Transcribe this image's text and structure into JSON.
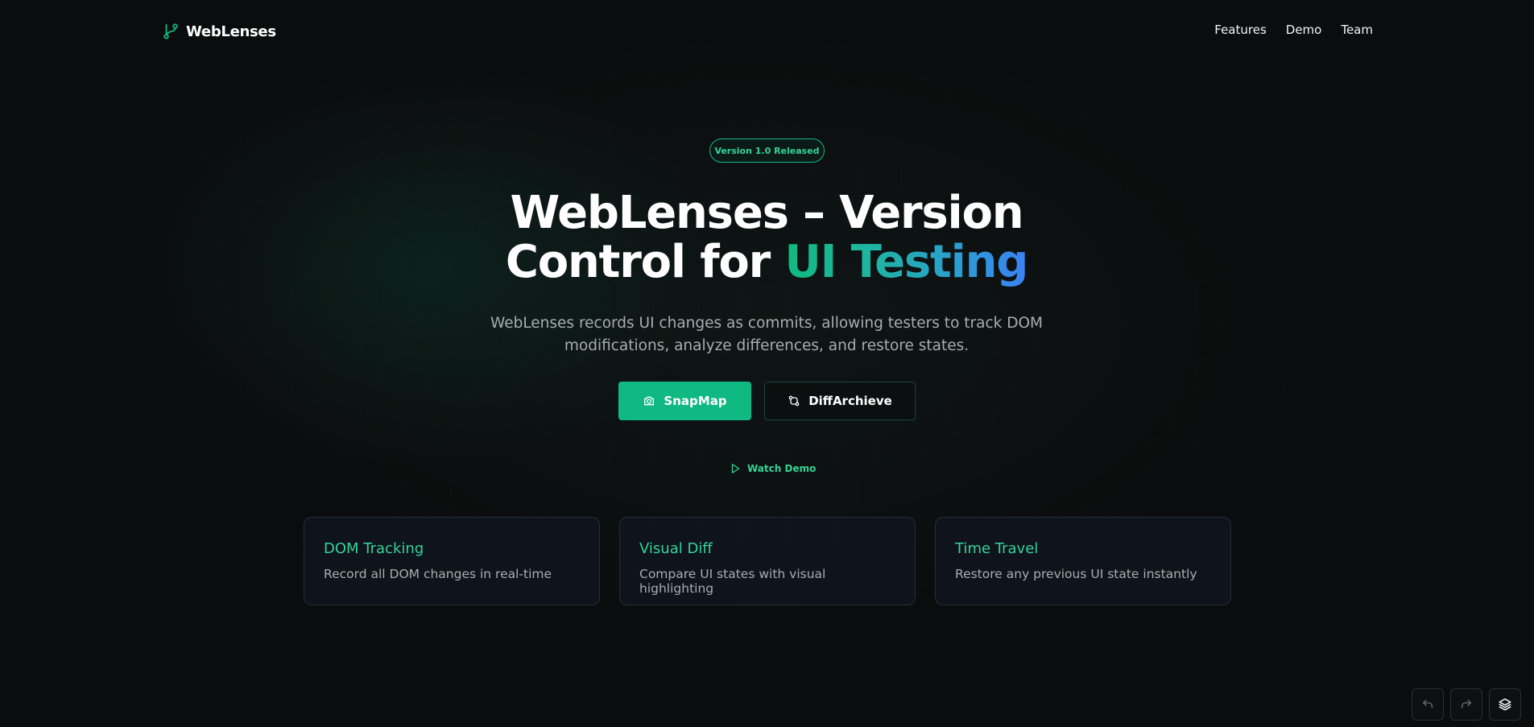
{
  "nav": {
    "brand": "WebLenses",
    "links": [
      {
        "label": "Features"
      },
      {
        "label": "Demo"
      },
      {
        "label": "Team"
      }
    ]
  },
  "hero": {
    "badge": "Version 1.0 Released",
    "title_line1": "WebLenses – Version",
    "title_line2_plain": "Control for ",
    "title_line2_accent": "UI Testing",
    "subtitle": "WebLenses records UI changes as commits, allowing testers to track DOM modifications, analyze differences, and restore states.",
    "primary_button": "SnapMap",
    "secondary_button": "DiffArchieve",
    "watch_demo": "Watch Demo"
  },
  "features": [
    {
      "title": "DOM Tracking",
      "description": "Record all DOM changes in real-time"
    },
    {
      "title": "Visual Diff",
      "description": "Compare UI states with visual highlighting"
    },
    {
      "title": "Time Travel",
      "description": "Restore any previous UI state instantly"
    }
  ],
  "toolbar": {
    "icons": [
      "undo-icon",
      "redo-icon",
      "layers-icon"
    ]
  },
  "colors": {
    "accent": "#10b981",
    "accent_light": "#34d399",
    "gradient_end": "#3b82f6",
    "background": "#0b0c0d",
    "card_border": "#262d38",
    "muted_text": "#a7adb3"
  }
}
